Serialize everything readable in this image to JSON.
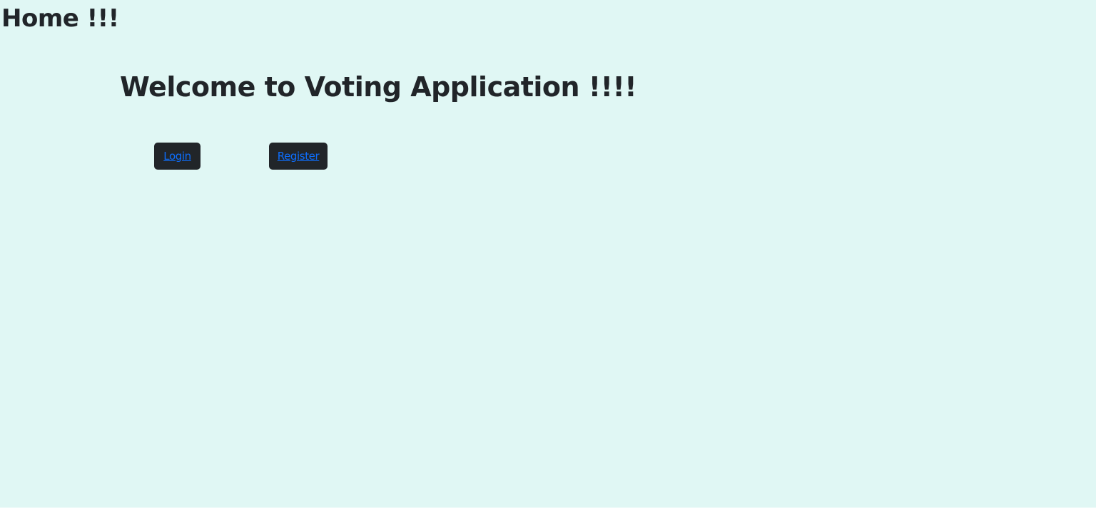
{
  "header": {
    "title": "Home !!!"
  },
  "main": {
    "welcome": "Welcome to Voting Application !!!!",
    "buttons": {
      "login_label": "Login",
      "register_label": "Register"
    }
  },
  "colors": {
    "background": "#e0f7f4",
    "button_background": "#212529",
    "link": "#0d6efd",
    "text": "#212529"
  }
}
